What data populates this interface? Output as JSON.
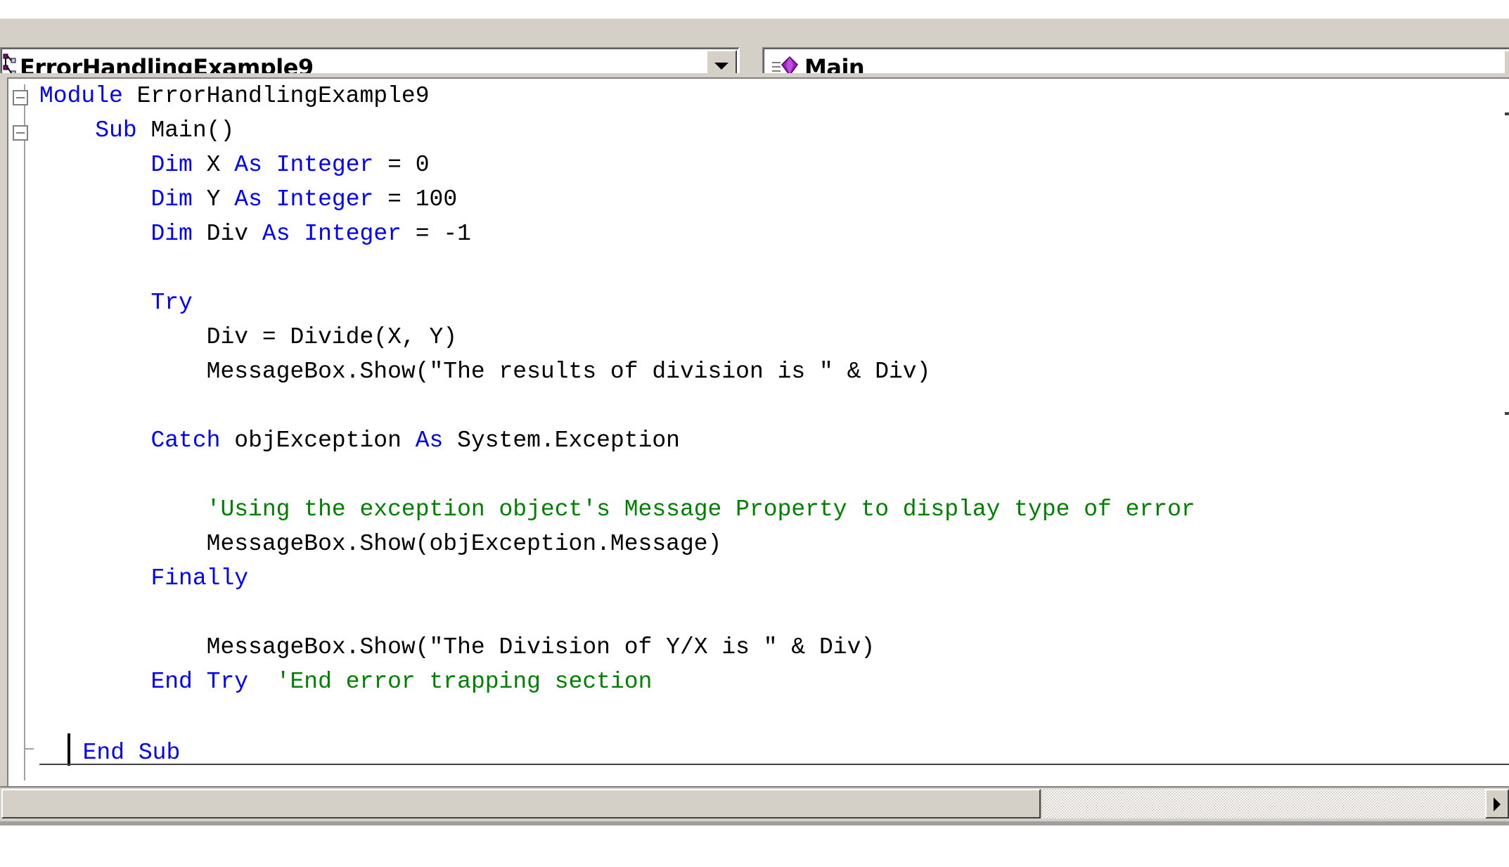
{
  "toolbar": {
    "class_dropdown": {
      "value": "ErrorHandlingExample9",
      "icon": "class-icon"
    },
    "method_dropdown": {
      "value": "Main",
      "icon": "method-icon"
    }
  },
  "editor": {
    "language": "Visual Basic .NET",
    "lines": [
      [
        {
          "t": "Module",
          "k": "kw"
        },
        {
          "t": " ErrorHandlingExample9",
          "k": "tx"
        }
      ],
      [
        {
          "t": "    ",
          "k": "tx"
        },
        {
          "t": "Sub",
          "k": "kw"
        },
        {
          "t": " Main()",
          "k": "tx"
        }
      ],
      [
        {
          "t": "        ",
          "k": "tx"
        },
        {
          "t": "Dim",
          "k": "kw"
        },
        {
          "t": " X ",
          "k": "tx"
        },
        {
          "t": "As",
          "k": "kw"
        },
        {
          "t": " ",
          "k": "tx"
        },
        {
          "t": "Integer",
          "k": "kw"
        },
        {
          "t": " = 0",
          "k": "tx"
        }
      ],
      [
        {
          "t": "        ",
          "k": "tx"
        },
        {
          "t": "Dim",
          "k": "kw"
        },
        {
          "t": " Y ",
          "k": "tx"
        },
        {
          "t": "As",
          "k": "kw"
        },
        {
          "t": " ",
          "k": "tx"
        },
        {
          "t": "Integer",
          "k": "kw"
        },
        {
          "t": " = 100",
          "k": "tx"
        }
      ],
      [
        {
          "t": "        ",
          "k": "tx"
        },
        {
          "t": "Dim",
          "k": "kw"
        },
        {
          "t": " Div ",
          "k": "tx"
        },
        {
          "t": "As",
          "k": "kw"
        },
        {
          "t": " ",
          "k": "tx"
        },
        {
          "t": "Integer",
          "k": "kw"
        },
        {
          "t": " = -1",
          "k": "tx"
        }
      ],
      [],
      [
        {
          "t": "        ",
          "k": "tx"
        },
        {
          "t": "Try",
          "k": "kw"
        }
      ],
      [
        {
          "t": "            Div = Divide(X, Y)",
          "k": "tx"
        }
      ],
      [
        {
          "t": "            MessageBox.Show(\"The results of division is \" & Div)",
          "k": "tx"
        }
      ],
      [],
      [
        {
          "t": "        ",
          "k": "tx"
        },
        {
          "t": "Catch",
          "k": "kw"
        },
        {
          "t": " objException ",
          "k": "tx"
        },
        {
          "t": "As",
          "k": "kw"
        },
        {
          "t": " System.Exception",
          "k": "tx"
        }
      ],
      [],
      [
        {
          "t": "            ",
          "k": "tx"
        },
        {
          "t": "'Using the exception object's Message Property to display type of error",
          "k": "cm"
        }
      ],
      [
        {
          "t": "            MessageBox.Show(objException.Message)",
          "k": "tx"
        }
      ],
      [
        {
          "t": "        ",
          "k": "tx"
        },
        {
          "t": "Finally",
          "k": "kw"
        }
      ],
      [],
      [
        {
          "t": "            MessageBox.Show(\"The Division of Y/X is \" & Div)",
          "k": "tx"
        }
      ],
      [
        {
          "t": "        ",
          "k": "tx"
        },
        {
          "t": "End",
          "k": "kw"
        },
        {
          "t": " ",
          "k": "tx"
        },
        {
          "t": "Try",
          "k": "kw"
        },
        {
          "t": "  ",
          "k": "tx"
        },
        {
          "t": "'End error trapping section",
          "k": "cm"
        }
      ],
      [],
      [
        {
          "t": "  ",
          "k": "tx"
        },
        {
          "t": "",
          "k": "caret"
        },
        {
          "t": "End",
          "k": "kw"
        },
        {
          "t": " ",
          "k": "tx"
        },
        {
          "t": "Sub",
          "k": "kw"
        }
      ]
    ]
  },
  "colors": {
    "keyword": "#0000ff",
    "comment": "#008000",
    "text": "#000000",
    "chrome": "#d4d0c8"
  }
}
